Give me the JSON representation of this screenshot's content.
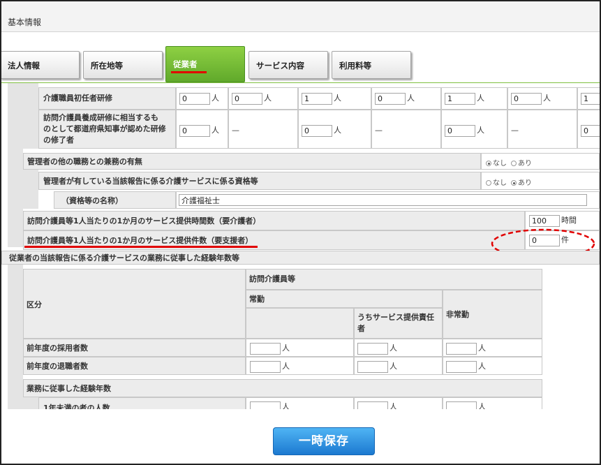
{
  "page_title": "基本情報",
  "tabs": [
    {
      "label": "法人情報"
    },
    {
      "label": "所在地等"
    },
    {
      "label": "従業者"
    },
    {
      "label": "サービス内容"
    },
    {
      "label": "利用料等"
    }
  ],
  "active_tab": "従業者",
  "table1": {
    "rows": {
      "initial_training": {
        "label": "介護職員初任者研修",
        "values": [
          "0",
          "0",
          "1",
          "0",
          "1",
          "0",
          "1"
        ],
        "unit": "人"
      },
      "equivalent_training": {
        "label": "訪問介護員養成研修に相当するものとして都道府県知事が認めた研修の修了者",
        "label_lines": [
          "訪問介護員養成研修に相当するも",
          "のとして都道府県知事が認めた研修",
          "の修了者"
        ],
        "values": [
          "0",
          "0",
          "0",
          "0"
        ],
        "dash": "—",
        "unit": "人"
      }
    }
  },
  "manager_other_duties": {
    "label": "管理者の他の職務との兼務の有無",
    "options": [
      "なし",
      "あり"
    ],
    "selected": "なし"
  },
  "manager_qualification": {
    "label": "管理者が有している当該報告に係る介護サービスに係る資格等",
    "options": [
      "なし",
      "あり"
    ],
    "selected": "あり"
  },
  "qualification_name": {
    "label": "（資格等の名称）",
    "value": "介護福祉士"
  },
  "service_hours": {
    "label": "訪問介護員等1人当たりの1か月のサービス提供時間数（要介護者）",
    "value": "100",
    "unit": "時間"
  },
  "service_count": {
    "label": "訪問介護員等1人当たりの1か月のサービス提供件数（要支援者）",
    "value": "0",
    "unit": "件"
  },
  "experience_section": {
    "title": "従業者の当該報告に係る介護サービスの業務に従事した経験年数等",
    "category_header": "区分",
    "group_header": "訪問介護員等",
    "fulltime_header": "常勤",
    "fulltime_sub_header_lines": [
      "うちサービス提供責任",
      "者"
    ],
    "parttime_header": "非常勤",
    "unit": "人",
    "rows": [
      {
        "label": "前年度の採用者数"
      },
      {
        "label": "前年度の退職者数"
      }
    ],
    "years_header": "業務に従事した経験年数",
    "years_row_label": "1年未満の者の人数"
  },
  "save_button": "一時保存",
  "colors": {
    "active_tab": "#6ab830",
    "annotation": "#e10000",
    "save_button": "#2a8ae0"
  }
}
